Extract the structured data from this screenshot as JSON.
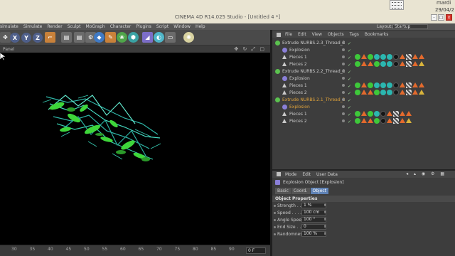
{
  "window": {
    "title": "CINEMA 4D R14.025 Studio - [Untitled 4 *]",
    "clock_time": "mardi",
    "clock_date": "29/04/2",
    "btn_min": "-",
    "btn_max": "□",
    "btn_close": "x"
  },
  "menubar": {
    "items": [
      "simulate",
      "Simulate",
      "Render",
      "Sculpt",
      "MoGraph",
      "Character",
      "Plugins",
      "Script",
      "Window",
      "Help"
    ],
    "layout_label": "Layout:",
    "layout_value": "Startup"
  },
  "toolbar": {
    "axis_x": "X",
    "axis_y": "Y",
    "axis_z": "Z"
  },
  "viewport": {
    "panel_label": "Panel",
    "nav_icons": "✥ ↻ ⤢ ▢"
  },
  "timeline": {
    "ticks": [
      "30",
      "35",
      "40",
      "45",
      "50",
      "55",
      "60",
      "65",
      "70",
      "75",
      "80",
      "85",
      "90"
    ],
    "frame_value": "0 F"
  },
  "object_manager": {
    "menu": [
      "File",
      "Edit",
      "View",
      "Objects",
      "Tags",
      "Bookmarks"
    ],
    "rows": [
      {
        "name": "Extrude NURBS.2.3_Thread_2",
        "indent": 0,
        "type": "extrude",
        "selected": false,
        "tags": []
      },
      {
        "name": "Explosion",
        "indent": 1,
        "type": "explosion",
        "selected": false,
        "tags": []
      },
      {
        "name": "Pieces 1",
        "indent": 1,
        "type": "poly",
        "selected": false,
        "tags": [
          "g",
          "o",
          "g",
          "t",
          "t",
          "t",
          "k",
          "o",
          "c",
          "o",
          "o"
        ]
      },
      {
        "name": "Pieces 2",
        "indent": 1,
        "type": "poly",
        "selected": false,
        "tags": [
          "g",
          "o",
          "o",
          "g",
          "t",
          "t",
          "k",
          "o",
          "c",
          "o",
          "y"
        ]
      },
      {
        "name": "Extrude NURBS.2.2_Thread_2",
        "indent": 0,
        "type": "extrude",
        "selected": false,
        "tags": []
      },
      {
        "name": "Explosion",
        "indent": 1,
        "type": "explosion",
        "selected": false,
        "tags": []
      },
      {
        "name": "Pieces 1",
        "indent": 1,
        "type": "poly",
        "selected": false,
        "tags": [
          "g",
          "o",
          "g",
          "t",
          "t",
          "t",
          "k",
          "o",
          "c",
          "o",
          "o"
        ]
      },
      {
        "name": "Pieces 2",
        "indent": 1,
        "type": "poly",
        "selected": false,
        "tags": [
          "g",
          "o",
          "o",
          "g",
          "t",
          "t",
          "k",
          "o",
          "c",
          "o",
          "y"
        ]
      },
      {
        "name": "Extrude NURBS.2.1_Thread_2",
        "indent": 0,
        "type": "extrude",
        "selected": true,
        "tags": []
      },
      {
        "name": "Explosion",
        "indent": 1,
        "type": "explosion",
        "selected": true,
        "tags": []
      },
      {
        "name": "Pieces 1",
        "indent": 1,
        "type": "poly",
        "selected": false,
        "tags": [
          "g",
          "o",
          "g",
          "t",
          "k",
          "o",
          "c",
          "o",
          "o"
        ]
      },
      {
        "name": "Pieces 2",
        "indent": 1,
        "type": "poly",
        "selected": false,
        "tags": [
          "g",
          "o",
          "o",
          "g",
          "k",
          "o",
          "c",
          "o",
          "y"
        ]
      }
    ]
  },
  "attribute_manager": {
    "menu": [
      "Mode",
      "Edit",
      "User Data"
    ],
    "tools": "◂ ▴ ◉ ⚙ ▦",
    "object_title": "Explosion Object [Explosion]",
    "tabs": [
      "Basic",
      "Coord.",
      "Object"
    ],
    "active_tab": "Object",
    "section": "Object Properties",
    "properties": [
      {
        "label": "Strength . . . . . .",
        "value": "1 %"
      },
      {
        "label": "Speed . . . . . . . .",
        "value": "100 cm"
      },
      {
        "label": "Angle Speed",
        "value": "100 °"
      },
      {
        "label": "End Size . . . . . .",
        "value": "0"
      },
      {
        "label": "Randomness",
        "value": "100 %"
      }
    ]
  },
  "colors": {
    "accent_selected": "#e0a33a",
    "viewport_bg": "#000000",
    "tab_active": "#5f82b5",
    "close_button": "#d9352b",
    "model_green": "#3ed63a",
    "model_cyan": "#2fb6a8"
  }
}
